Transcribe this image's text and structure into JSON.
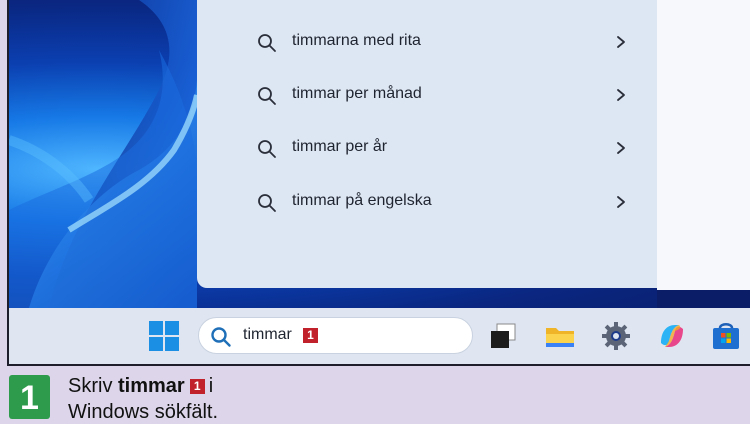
{
  "search_panel": {
    "suggestions": [
      {
        "label": "timmarna med rita"
      },
      {
        "label": "timmar per månad"
      },
      {
        "label": "timmar per år"
      },
      {
        "label": "timmar på engelska"
      }
    ]
  },
  "taskbar": {
    "search": {
      "query": "timmar",
      "badge": "1"
    },
    "apps": [
      {
        "icon": "task-view-icon"
      },
      {
        "icon": "file-explorer-icon"
      },
      {
        "icon": "settings-gear-icon"
      },
      {
        "icon": "copilot-icon"
      },
      {
        "icon": "microsoft-store-icon"
      }
    ]
  },
  "caption": {
    "step_number": "1",
    "prefix": "Skriv",
    "keyword": "timmar",
    "badge": "1",
    "suffix": "i",
    "line2": "Windows sökfält."
  },
  "colors": {
    "accent_badge": "#c0212b",
    "step_green": "#2e9a4b",
    "panel_bg": "#dde6f3",
    "taskbar_bg": "#dfe6f2"
  }
}
